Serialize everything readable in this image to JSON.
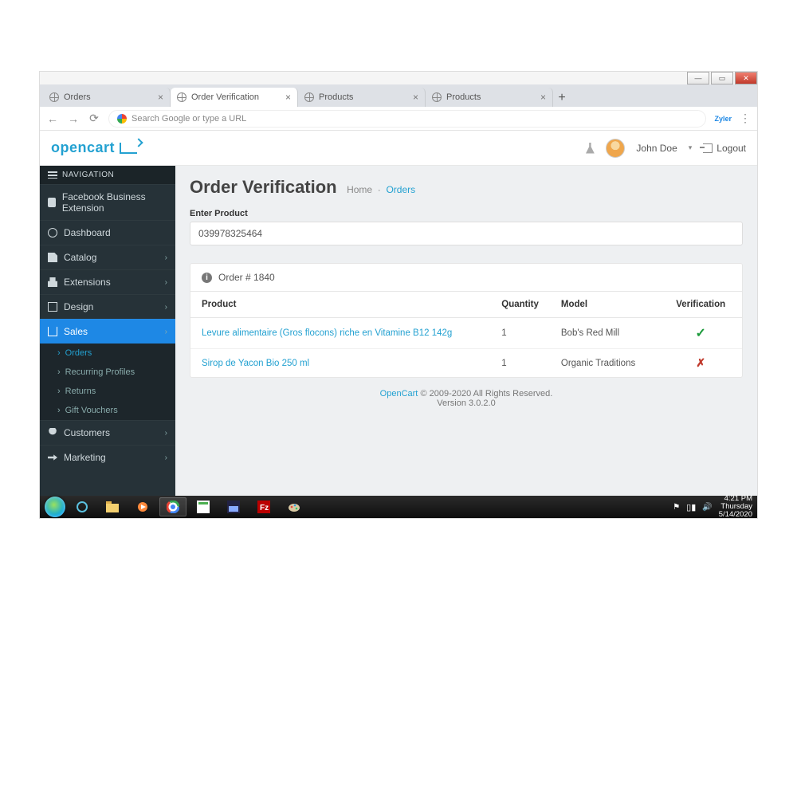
{
  "browser": {
    "tabs": [
      {
        "title": "Orders",
        "active": false
      },
      {
        "title": "Order Verification",
        "active": true
      },
      {
        "title": "Products",
        "active": false
      },
      {
        "title": "Products",
        "active": false
      }
    ],
    "url_placeholder": "Search Google or type a URL",
    "extension_badge": "Zyler"
  },
  "header": {
    "brand": "opencart",
    "user": "John Doe",
    "logout": "Logout"
  },
  "sidebar": {
    "heading": "NAVIGATION",
    "items": [
      {
        "label": "Facebook Business Extension"
      },
      {
        "label": "Dashboard"
      },
      {
        "label": "Catalog"
      },
      {
        "label": "Extensions"
      },
      {
        "label": "Design"
      },
      {
        "label": "Sales",
        "active": true,
        "children": [
          "Orders",
          "Recurring Profiles",
          "Returns",
          "Gift Vouchers"
        ]
      },
      {
        "label": "Customers"
      },
      {
        "label": "Marketing"
      }
    ]
  },
  "page": {
    "title": "Order Verification",
    "breadcrumb": [
      "Home",
      "Orders"
    ],
    "input_label": "Enter Product",
    "input_value": "039978325464"
  },
  "order": {
    "heading": "Order # 1840",
    "columns": [
      "Product",
      "Quantity",
      "Model",
      "Verification"
    ],
    "rows": [
      {
        "product": "Levure alimentaire (Gros flocons) riche en Vitamine B12 142g",
        "quantity": "1",
        "model": "Bob's Red Mill",
        "verified": true
      },
      {
        "product": "Sirop de Yacon Bio 250 ml",
        "quantity": "1",
        "model": "Organic Traditions",
        "verified": false
      }
    ]
  },
  "footer": {
    "link": "OpenCart",
    "text": " © 2009-2020 All Rights Reserved.",
    "version": "Version 3.0.2.0"
  },
  "taskbar": {
    "time": "4:21 PM",
    "day": "Thursday",
    "date": "5/14/2020"
  }
}
